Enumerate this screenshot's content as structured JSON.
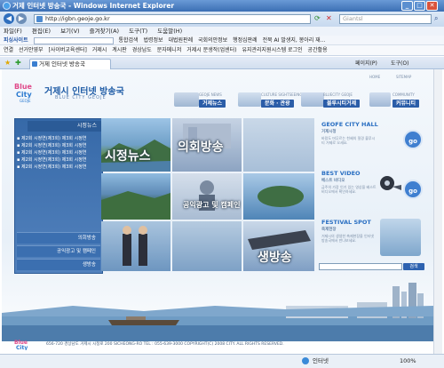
{
  "window": {
    "title": "거제 인터넷 방송국 - Windows Internet Explorer"
  },
  "toolbar": {
    "url": "http://igbn.geoje.go.kr",
    "search_placeholder": "Giantsl",
    "refresh_icon": "refresh-icon",
    "stop_icon": "stop-icon"
  },
  "menu": [
    "파일(F)",
    "편집(E)",
    "보기(V)",
    "즐겨찾기(A)",
    "도구(T)",
    "도움말(H)"
  ],
  "links_bar": {
    "label": "피싱사이트",
    "items": [
      "통합검색",
      "법령정보",
      "대법원판례",
      "국회의안정보",
      "행정심판례",
      "전북 AI 발생지, 봉아리 재..."
    ]
  },
  "fav_bar": {
    "label": "연결",
    "items": [
      "선거안영부",
      "[사이버교육센터]",
      "거제시",
      "계시판",
      "경상남도",
      "문자메니저",
      "거제시 문생작(업센터)",
      "유지관리지원시스템 로그인",
      "공간활용"
    ]
  },
  "tab": {
    "title": "거제 인터넷 방송국"
  },
  "right_tools": {
    "page": "페이지(P)",
    "tools": "도구(O)"
  },
  "site": {
    "logo_text": "Blue City GEOJE",
    "site_title": "거제시 인터넷 방송국",
    "site_subtitle": "BLUE CITY GEOJE",
    "top_links": [
      "HOME",
      "SITEMAP"
    ],
    "nav": [
      {
        "sub": "GEOJE NEWS",
        "label": "거제뉴스"
      },
      {
        "sub": "CULTURE SIGHTSEEING",
        "label": "문화 · 관광"
      },
      {
        "sub": "BLUECITY GEOJE",
        "label": "블루시티거제"
      },
      {
        "sub": "COMMUNITY",
        "label": "커뮤니티"
      }
    ],
    "left_panel": {
      "header": "시정뉴스",
      "links": [
        "제2회 시정연(제3회) 제3회 시정연",
        "제2회 시정연(제3회) 제3회 시정연",
        "제2회 시정연(제3회) 제3회 시정연",
        "제2회 시정연(제3회) 제3회 시정연",
        "제2회 시정연(제3회) 제3회 시정연"
      ],
      "buttons": [
        "의회방송",
        "공익광고 및 캠페인",
        "생방송"
      ]
    },
    "tiles": {
      "news": "시정뉴스",
      "council": "의회방송",
      "campaign": "공익광고 및 캠페인",
      "live": "생방송"
    },
    "right_panel": {
      "cityhall_title": "GEOFE CITY HALL",
      "cityhall_sub": "거제시청",
      "cityhall_desc": "바람도 머무르는 천혜의 절경 블루시티 거제로 오세요.",
      "bestvideo_title": "BEST VIDEO",
      "bestvideo_sub": "베스트 비디오",
      "bestvideo_desc": "금주의 가장 인기 있는 영상을 베스트비디오에서 확인하세요.",
      "festival_title": "FESTIVAL SPOT",
      "festival_sub": "축제현장",
      "festival_desc": "거제시의 생생한 축제현장을 인터넷 방송국에서 만나보세요.",
      "go": "go",
      "search_go": "검색"
    },
    "footer": "656-720 경상남도 거제시 시청로 200 SICHEONG-RO  TEL : 055-639-3000 COPYRIGHT(C) 2008 CITY. ALL RIGHTS RESERVED."
  },
  "status": {
    "zone": "인터넷",
    "zoom": "100%"
  }
}
